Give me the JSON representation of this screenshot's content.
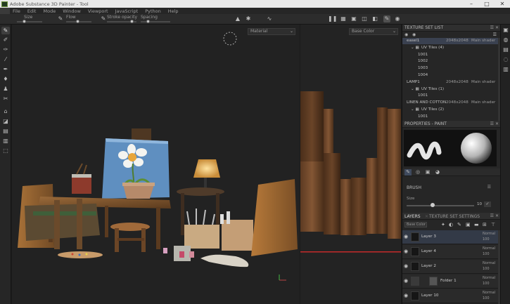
{
  "window": {
    "title": "Adobe Substance 3D Painter - Tool"
  },
  "menu": {
    "items": [
      "File",
      "Edit",
      "Mode",
      "Window",
      "Viewport",
      "JavaScript",
      "Python",
      "Help"
    ]
  },
  "toolbar": {
    "size_label": "Size",
    "size_value": 0.3,
    "flow_label": "Flow",
    "flow_value": 0.45,
    "stroke_opacity_label": "Stroke opacity",
    "stroke_opacity_value": 0.85,
    "spacing_label": "Spacing",
    "spacing_value": 0.25
  },
  "viewport3d": {
    "mode_dropdown": "Material"
  },
  "viewport2d": {
    "mode_dropdown": "Base Color"
  },
  "texture_set_list": {
    "title": "TEXTURE SET LIST",
    "rows": [
      {
        "name": "easel1",
        "size": "2048x2048",
        "shader": "Main shader",
        "selected": true,
        "level": 0
      },
      {
        "name": "UV Tiles (4)",
        "size": "",
        "shader": "",
        "selected": false,
        "level": 1
      },
      {
        "name": "1001",
        "size": "",
        "shader": "",
        "selected": false,
        "level": 2
      },
      {
        "name": "1002",
        "size": "",
        "shader": "",
        "selected": false,
        "level": 2
      },
      {
        "name": "1003",
        "size": "",
        "shader": "",
        "selected": false,
        "level": 2
      },
      {
        "name": "1004",
        "size": "",
        "shader": "",
        "selected": false,
        "level": 2
      },
      {
        "name": "LAMP1",
        "size": "2048x2048",
        "shader": "Main shader",
        "selected": false,
        "level": 0
      },
      {
        "name": "UV Tiles (1)",
        "size": "",
        "shader": "",
        "selected": false,
        "level": 1
      },
      {
        "name": "1001",
        "size": "",
        "shader": "",
        "selected": false,
        "level": 2
      },
      {
        "name": "LINEN AND COTTON",
        "size": "2048x2048",
        "shader": "Main shader",
        "selected": false,
        "level": 0
      },
      {
        "name": "UV Tiles (2)",
        "size": "",
        "shader": "",
        "selected": false,
        "level": 1
      },
      {
        "name": "1001",
        "size": "",
        "shader": "",
        "selected": false,
        "level": 2
      }
    ]
  },
  "properties": {
    "title": "PROPERTIES - PAINT",
    "brush_section": "BRUSH",
    "size_label": "Size",
    "size_value": "10"
  },
  "layers": {
    "tab_layers": "LAYERS",
    "tab_texture_set_settings": "TEXTURE SET SETTINGS",
    "blend_dropdown": "Base Color",
    "rows": [
      {
        "name": "Layer 3",
        "blend": "Normal",
        "opacity": "100",
        "selected": true,
        "folder": false
      },
      {
        "name": "Layer 4",
        "blend": "Normal",
        "opacity": "100",
        "selected": false,
        "folder": false
      },
      {
        "name": "Layer 2",
        "blend": "Normal",
        "opacity": "100",
        "selected": false,
        "folder": false
      },
      {
        "name": "Folder 1",
        "blend": "Normal",
        "opacity": "100",
        "selected": false,
        "folder": true
      },
      {
        "name": "Layer 10",
        "blend": "Normal",
        "opacity": "100",
        "selected": false,
        "folder": false
      }
    ]
  },
  "colors": {
    "accent": "#3f4a5e",
    "selection": "#333a47",
    "background": "#1b1b1b"
  }
}
